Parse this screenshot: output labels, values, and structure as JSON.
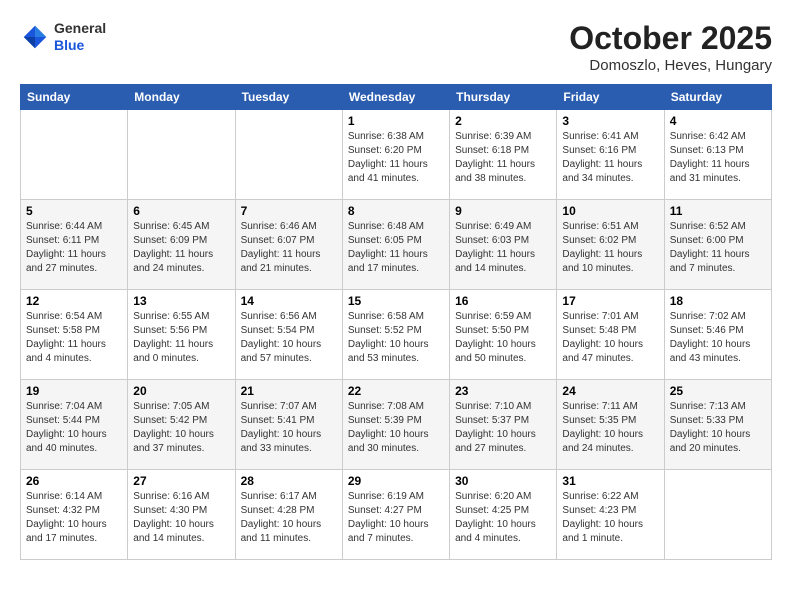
{
  "header": {
    "logo": {
      "general": "General",
      "blue": "Blue"
    },
    "title": "October 2025",
    "subtitle": "Domoszlo, Heves, Hungary"
  },
  "weekdays": [
    "Sunday",
    "Monday",
    "Tuesday",
    "Wednesday",
    "Thursday",
    "Friday",
    "Saturday"
  ],
  "weeks": [
    [
      {
        "day": "",
        "info": ""
      },
      {
        "day": "",
        "info": ""
      },
      {
        "day": "",
        "info": ""
      },
      {
        "day": "1",
        "info": "Sunrise: 6:38 AM\nSunset: 6:20 PM\nDaylight: 11 hours\nand 41 minutes."
      },
      {
        "day": "2",
        "info": "Sunrise: 6:39 AM\nSunset: 6:18 PM\nDaylight: 11 hours\nand 38 minutes."
      },
      {
        "day": "3",
        "info": "Sunrise: 6:41 AM\nSunset: 6:16 PM\nDaylight: 11 hours\nand 34 minutes."
      },
      {
        "day": "4",
        "info": "Sunrise: 6:42 AM\nSunset: 6:13 PM\nDaylight: 11 hours\nand 31 minutes."
      }
    ],
    [
      {
        "day": "5",
        "info": "Sunrise: 6:44 AM\nSunset: 6:11 PM\nDaylight: 11 hours\nand 27 minutes."
      },
      {
        "day": "6",
        "info": "Sunrise: 6:45 AM\nSunset: 6:09 PM\nDaylight: 11 hours\nand 24 minutes."
      },
      {
        "day": "7",
        "info": "Sunrise: 6:46 AM\nSunset: 6:07 PM\nDaylight: 11 hours\nand 21 minutes."
      },
      {
        "day": "8",
        "info": "Sunrise: 6:48 AM\nSunset: 6:05 PM\nDaylight: 11 hours\nand 17 minutes."
      },
      {
        "day": "9",
        "info": "Sunrise: 6:49 AM\nSunset: 6:03 PM\nDaylight: 11 hours\nand 14 minutes."
      },
      {
        "day": "10",
        "info": "Sunrise: 6:51 AM\nSunset: 6:02 PM\nDaylight: 11 hours\nand 10 minutes."
      },
      {
        "day": "11",
        "info": "Sunrise: 6:52 AM\nSunset: 6:00 PM\nDaylight: 11 hours\nand 7 minutes."
      }
    ],
    [
      {
        "day": "12",
        "info": "Sunrise: 6:54 AM\nSunset: 5:58 PM\nDaylight: 11 hours\nand 4 minutes."
      },
      {
        "day": "13",
        "info": "Sunrise: 6:55 AM\nSunset: 5:56 PM\nDaylight: 11 hours\nand 0 minutes."
      },
      {
        "day": "14",
        "info": "Sunrise: 6:56 AM\nSunset: 5:54 PM\nDaylight: 10 hours\nand 57 minutes."
      },
      {
        "day": "15",
        "info": "Sunrise: 6:58 AM\nSunset: 5:52 PM\nDaylight: 10 hours\nand 53 minutes."
      },
      {
        "day": "16",
        "info": "Sunrise: 6:59 AM\nSunset: 5:50 PM\nDaylight: 10 hours\nand 50 minutes."
      },
      {
        "day": "17",
        "info": "Sunrise: 7:01 AM\nSunset: 5:48 PM\nDaylight: 10 hours\nand 47 minutes."
      },
      {
        "day": "18",
        "info": "Sunrise: 7:02 AM\nSunset: 5:46 PM\nDaylight: 10 hours\nand 43 minutes."
      }
    ],
    [
      {
        "day": "19",
        "info": "Sunrise: 7:04 AM\nSunset: 5:44 PM\nDaylight: 10 hours\nand 40 minutes."
      },
      {
        "day": "20",
        "info": "Sunrise: 7:05 AM\nSunset: 5:42 PM\nDaylight: 10 hours\nand 37 minutes."
      },
      {
        "day": "21",
        "info": "Sunrise: 7:07 AM\nSunset: 5:41 PM\nDaylight: 10 hours\nand 33 minutes."
      },
      {
        "day": "22",
        "info": "Sunrise: 7:08 AM\nSunset: 5:39 PM\nDaylight: 10 hours\nand 30 minutes."
      },
      {
        "day": "23",
        "info": "Sunrise: 7:10 AM\nSunset: 5:37 PM\nDaylight: 10 hours\nand 27 minutes."
      },
      {
        "day": "24",
        "info": "Sunrise: 7:11 AM\nSunset: 5:35 PM\nDaylight: 10 hours\nand 24 minutes."
      },
      {
        "day": "25",
        "info": "Sunrise: 7:13 AM\nSunset: 5:33 PM\nDaylight: 10 hours\nand 20 minutes."
      }
    ],
    [
      {
        "day": "26",
        "info": "Sunrise: 6:14 AM\nSunset: 4:32 PM\nDaylight: 10 hours\nand 17 minutes."
      },
      {
        "day": "27",
        "info": "Sunrise: 6:16 AM\nSunset: 4:30 PM\nDaylight: 10 hours\nand 14 minutes."
      },
      {
        "day": "28",
        "info": "Sunrise: 6:17 AM\nSunset: 4:28 PM\nDaylight: 10 hours\nand 11 minutes."
      },
      {
        "day": "29",
        "info": "Sunrise: 6:19 AM\nSunset: 4:27 PM\nDaylight: 10 hours\nand 7 minutes."
      },
      {
        "day": "30",
        "info": "Sunrise: 6:20 AM\nSunset: 4:25 PM\nDaylight: 10 hours\nand 4 minutes."
      },
      {
        "day": "31",
        "info": "Sunrise: 6:22 AM\nSunset: 4:23 PM\nDaylight: 10 hours\nand 1 minute."
      },
      {
        "day": "",
        "info": ""
      }
    ]
  ]
}
